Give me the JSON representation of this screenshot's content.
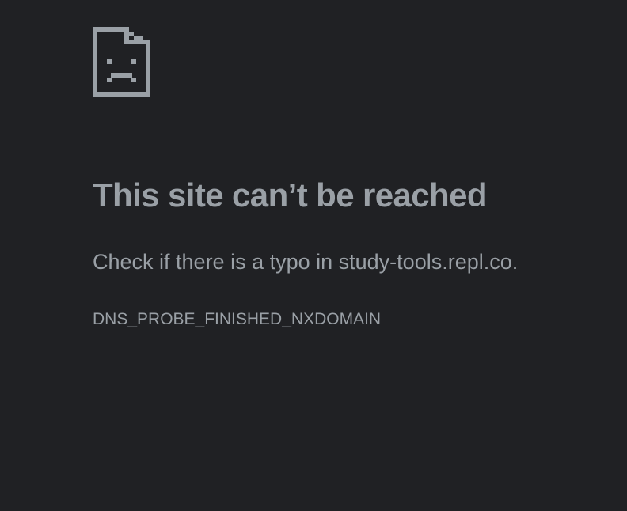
{
  "page": {
    "background": "#202124",
    "text_color": "#9aa0a6"
  },
  "error": {
    "icon": "sad-page-icon",
    "heading": "This site can’t be reached",
    "suggestion": "Check if there is a typo in study-tools.repl.co.",
    "code": "DNS_PROBE_FINISHED_NXDOMAIN"
  }
}
